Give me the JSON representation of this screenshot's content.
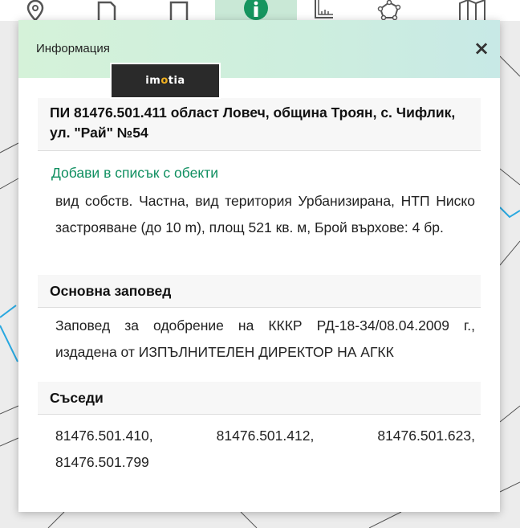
{
  "modal": {
    "title": "Информация",
    "close_label": "×",
    "logo_text_1": "im",
    "logo_text_o": "o",
    "logo_text_2": "tia"
  },
  "parcel": {
    "title": "ПИ 81476.501.411 област Ловеч, община Троян, с. Чифлик, ул. \"Рай\" №54",
    "add_link": "Добави в списък с обекти",
    "description": "вид собств. Частна, вид територия Урбанизирана, НТП Ниско застрояване (до 10 m), площ 521 кв. м, Брой върхове: 4 бр."
  },
  "order": {
    "heading": "Основна заповед",
    "text": "Заповед за одобрение на КККР РД-18-34/08.04.2009 г., издадена от ИЗПЪЛНИТЕЛЕН ДИРЕКТОР НА АГКК"
  },
  "neighbors": {
    "heading": "Съседи",
    "items": [
      "81476.501.410,",
      "81476.501.412,",
      "81476.501.623,",
      "81476.501.799"
    ]
  },
  "toolbar": {
    "tools": [
      "location-pin-icon",
      "document-icon",
      "page-icon",
      "info-icon",
      "ruler-icon",
      "polygon-icon",
      "map-icon"
    ],
    "active": "info-icon"
  }
}
